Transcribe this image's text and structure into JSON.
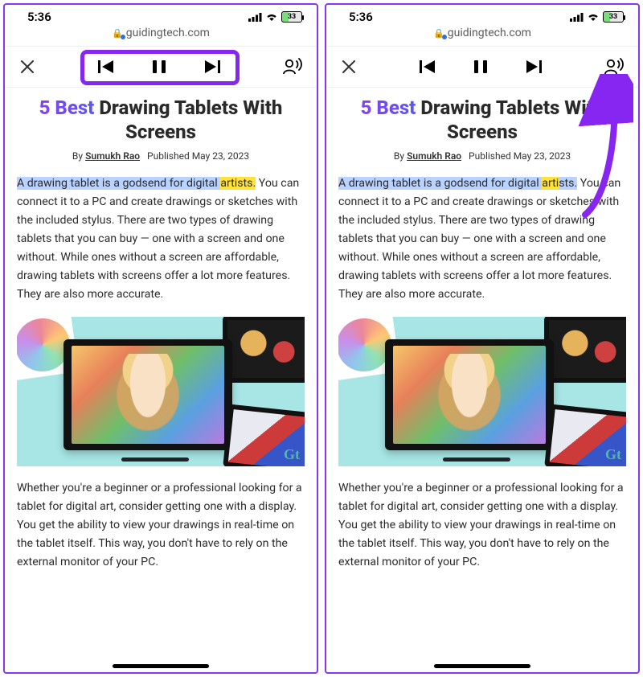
{
  "status": {
    "time": "5:36",
    "battery_pct": "33"
  },
  "url": {
    "host": "guidingtech.com"
  },
  "article": {
    "title_grad": "5 Best",
    "title_rest": "Drawing Tablets With Screens",
    "by_prefix": "By ",
    "author": "Sumukh Rao",
    "pub_prefix": "Published ",
    "pub_date": "May 23, 2023",
    "para1_hl_blue_a": "A drawing tablet is a godsend for digital ",
    "para1_hl_yellow_left": "artists.",
    "para1_hl_yellow_right_a": "arti",
    "para1_hl_blue_right_b": "sts.",
    "para1_rest": " You can connect it to a PC and create drawings or sketches with the included stylus. There are two types of drawing tablets that you can buy — one with a screen and one without. While ones without a screen are affordable, drawing tablets with screens offer a lot more features. They are also more accurate.",
    "para2": "Whether you're a beginner or a professional looking for a tablet for digital art, consider getting one with a display. You get the ability to view your drawings in real-time on the tablet itself. This way, you don't have to rely on the external monitor of your PC."
  },
  "icons": {
    "close": "close-icon",
    "prev": "skip-back-icon",
    "pausel": "pause-icon",
    "playr": "play-icon",
    "next": "skip-forward-icon",
    "voice": "voice-icon"
  },
  "hero": {
    "watermark": "Gt"
  }
}
